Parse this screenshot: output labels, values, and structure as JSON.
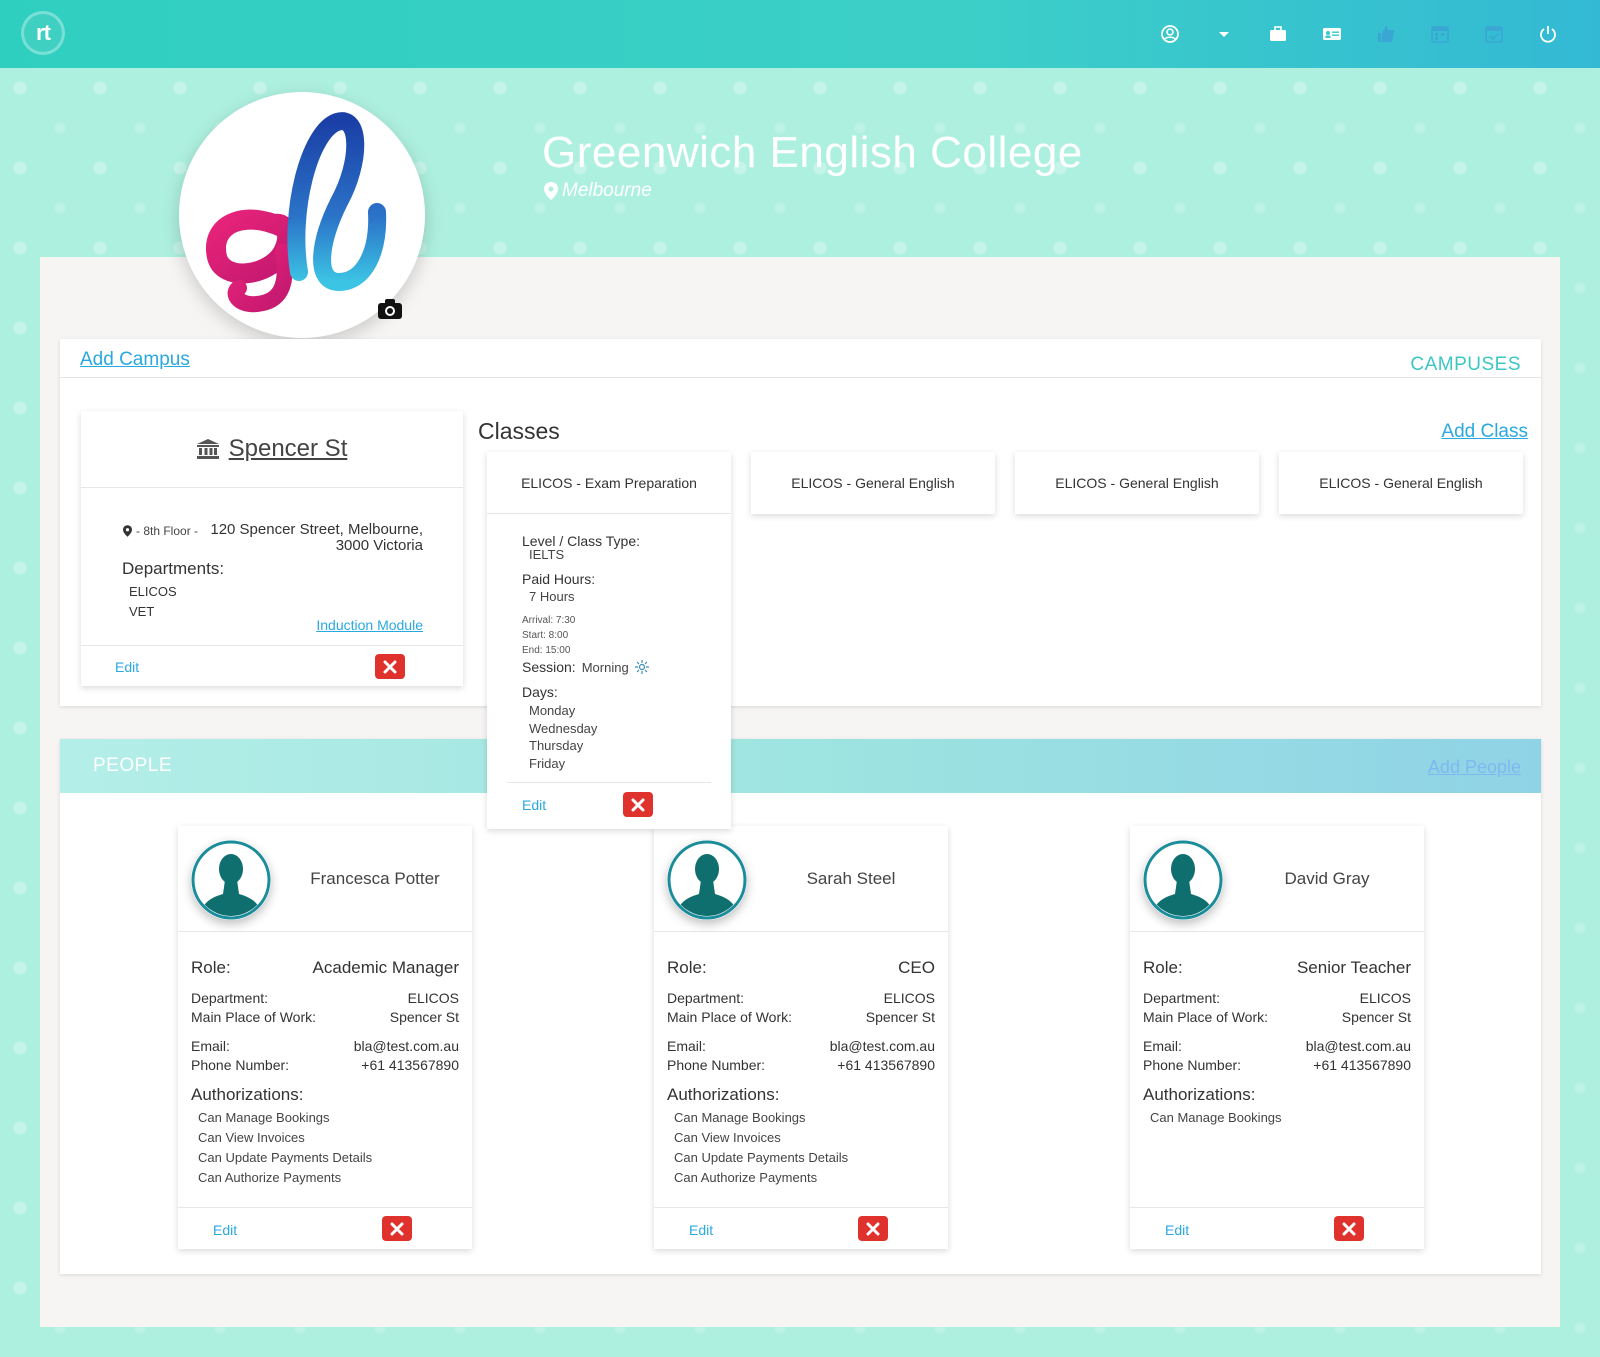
{
  "header": {
    "logo": "rt",
    "nav_icons": [
      "user-circle-icon",
      "caret-down-icon",
      "briefcase-icon",
      "id-card-icon",
      "thumbs-up-icon",
      "calendar-grid-icon",
      "calendar-check-icon",
      "power-icon"
    ]
  },
  "school": {
    "name": "Greenwich English College",
    "location": "Melbourne"
  },
  "campuses": {
    "add_label": "Add Campus",
    "section_label": "CAMPUSES",
    "campus": {
      "name": "Spencer St",
      "floor": "- 8th Floor -",
      "address_line1": "120 Spencer Street, Melbourne,",
      "address_line2": "3000 Victoria",
      "departments_label": "Departments:",
      "departments": [
        "ELICOS",
        "VET"
      ],
      "induction_label": "Induction Module",
      "edit_label": "Edit"
    }
  },
  "classes": {
    "title": "Classes",
    "add_label": "Add Class",
    "items": [
      {
        "name": "ELICOS - Exam Preparation",
        "level_label": "Level / Class Type:",
        "level": "IELTS",
        "paid_hours_label": "Paid Hours:",
        "paid_hours": "7 Hours",
        "arrival": "Arrival:  7:30",
        "start": "Start:  8:00",
        "end": "End:  15:00",
        "session_label": "Session:",
        "session": "Morning",
        "days_label": "Days:",
        "days": [
          "Monday",
          "Wednesday",
          "Thursday",
          "Friday"
        ],
        "edit_label": "Edit"
      },
      {
        "name": "ELICOS - General English"
      },
      {
        "name": "ELICOS - General English"
      },
      {
        "name": "ELICOS - General English"
      }
    ]
  },
  "people": {
    "section_label": "PEOPLE",
    "add_label": "Add People",
    "labels": {
      "role": "Role:",
      "department": "Department:",
      "workplace": "Main Place of Work:",
      "email": "Email:",
      "phone": "Phone Number:",
      "auth": "Authorizations:",
      "edit": "Edit"
    },
    "items": [
      {
        "name": "Francesca Potter",
        "role": "Academic Manager",
        "department": "ELICOS",
        "workplace": "Spencer St",
        "email": "bla@test.com.au",
        "phone": "+61 413567890",
        "auths": [
          "Can Manage Bookings",
          "Can View Invoices",
          "Can Update Payments Details",
          "Can Authorize Payments"
        ]
      },
      {
        "name": "Sarah Steel",
        "role": "CEO",
        "department": "ELICOS",
        "workplace": "Spencer St",
        "email": "bla@test.com.au",
        "phone": "+61 413567890",
        "auths": [
          "Can Manage Bookings",
          "Can View Invoices",
          "Can Update Payments Details",
          "Can Authorize Payments"
        ]
      },
      {
        "name": "David Gray",
        "role": "Senior Teacher",
        "department": "ELICOS",
        "workplace": "Spencer St",
        "email": "bla@test.com.au",
        "phone": "+61 413567890",
        "auths": [
          "Can Manage Bookings"
        ]
      }
    ]
  },
  "colors": {
    "accent": "#3cc7c4",
    "link": "#2aa9e0",
    "danger": "#e0322d",
    "avatar": "#0f6e6e"
  }
}
